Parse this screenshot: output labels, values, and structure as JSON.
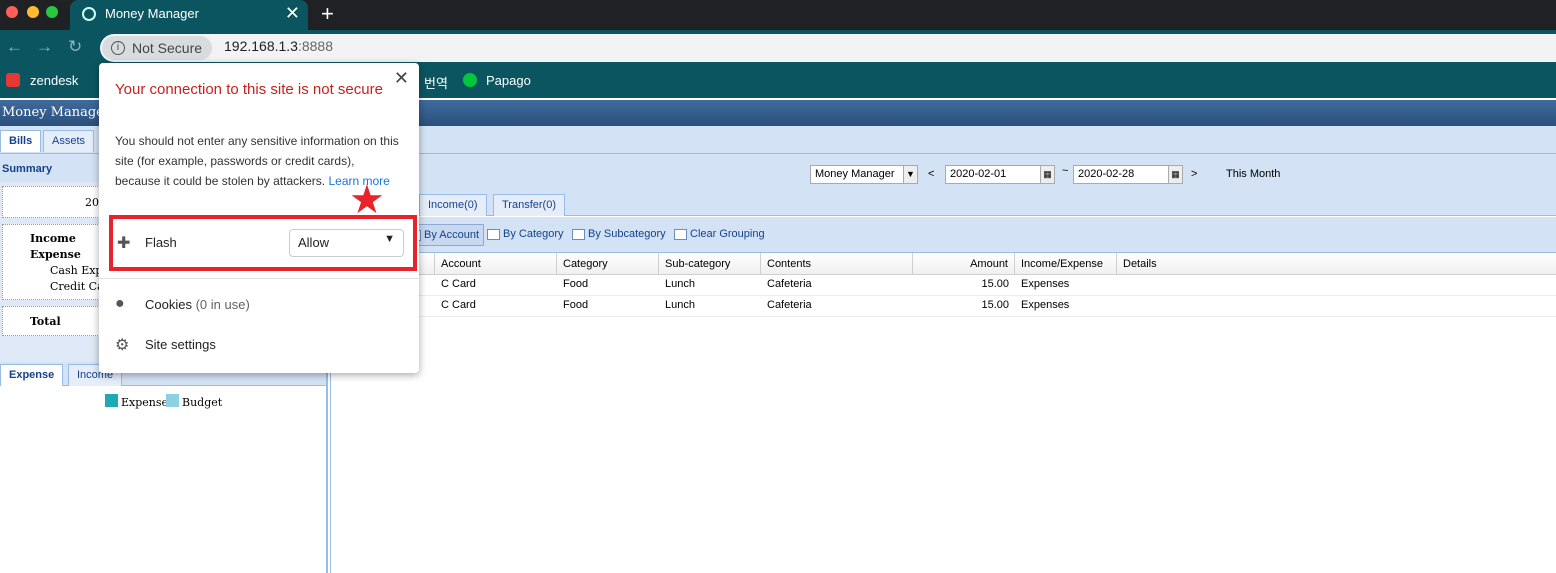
{
  "browser": {
    "tab_title": "Money Manager",
    "tab_close": "✕",
    "new_tab": "+",
    "not_secure": "Not Secure",
    "url_host": "192.168.1.3",
    "url_port": ":8888",
    "bookmarks": [
      {
        "label": "zendesk",
        "color": "#e53935"
      },
      {
        "label": "번역",
        "color": ""
      },
      {
        "label": "Papago",
        "color": "#00c73c"
      }
    ]
  },
  "app": {
    "title": "Money Manager",
    "top_tabs": [
      "Bills",
      "Assets"
    ],
    "summary": {
      "header": "Summary",
      "date_partial": "20",
      "income": "Income",
      "expense": "Expense",
      "cash_expense": "Cash Expe",
      "credit_card": "Credit Car",
      "total": "Total"
    },
    "lower_tabs": [
      "Expense",
      "Income"
    ],
    "legend": [
      {
        "label": "Expense",
        "color": "#20a8b4"
      },
      {
        "label": "Budget",
        "color": "#8dd0e2"
      }
    ],
    "filter": {
      "book_select": "Money Manager",
      "prev": "<",
      "from_date": "2020-02-01",
      "tilde": "~",
      "to_date": "2020-02-28",
      "next": ">",
      "period": "This Month"
    },
    "mid_tabs": [
      "Income(0)",
      "Transfer(0)"
    ],
    "group_buttons": [
      "By Account",
      "By Category",
      "By Subcategory",
      "Clear Grouping"
    ],
    "grid": {
      "columns": [
        "Account",
        "Category",
        "Sub-category",
        "Contents",
        "Amount",
        "Income/Expense",
        "Details"
      ],
      "rows": [
        [
          "C Card",
          "Food",
          "Lunch",
          "Cafeteria",
          "15.00",
          "Expenses",
          ""
        ],
        [
          "C Card",
          "Food",
          "Lunch",
          "Cafeteria",
          "15.00",
          "Expenses",
          ""
        ]
      ]
    }
  },
  "popup": {
    "close": "✕",
    "title": "Your connection to this site is not secure",
    "body": "You should not enter any sensitive information on this site (for example, passwords or credit cards), because it could be stolen by attackers.",
    "learn_more": "Learn more",
    "flash_label": "Flash",
    "flash_value": "Allow",
    "cookies_label": "Cookies",
    "cookies_count": "(0 in use)",
    "site_settings": "Site settings",
    "highlight_color": "#e8232b"
  }
}
